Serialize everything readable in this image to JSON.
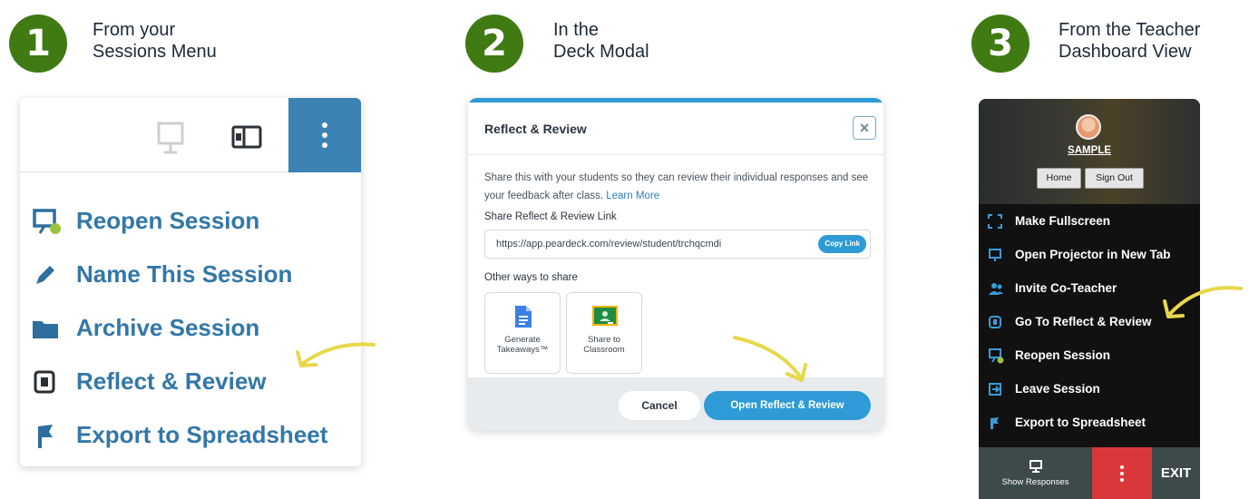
{
  "steps": [
    {
      "number": "1",
      "line1": "From your",
      "line2": "Sessions Menu"
    },
    {
      "number": "2",
      "line1": "In the",
      "line2": "Deck Modal"
    },
    {
      "number": "3",
      "line1": "From the Teacher",
      "line2": "Dashboard View"
    }
  ],
  "sessions_menu": {
    "items": [
      {
        "label": "Reopen Session",
        "icon": "projector-icon"
      },
      {
        "label": "Name This Session",
        "icon": "pencil-icon"
      },
      {
        "label": "Archive Session",
        "icon": "folder-icon"
      },
      {
        "label": "Reflect & Review",
        "icon": "reflect-icon"
      },
      {
        "label": "Export to Spreadsheet",
        "icon": "export-icon"
      }
    ]
  },
  "deck_modal": {
    "title": "Reflect & Review",
    "close": "×",
    "description": "Share this with your students so they can review their individual responses and see your feedback after class.",
    "learn_more": "Learn More",
    "link_label": "Share Reflect & Review Link",
    "link_value": "https://app.peardeck.com/review/student/trchqcmdi",
    "copy_label": "Copy Link",
    "other_label": "Other ways to share",
    "cards": [
      {
        "line1": "Generate",
        "line2": "Takeaways™",
        "icon": "google-docs-icon"
      },
      {
        "line1": "Share to",
        "line2": "Classroom",
        "icon": "google-classroom-icon"
      }
    ],
    "cancel_label": "Cancel",
    "open_label": "Open Reflect & Review"
  },
  "dashboard": {
    "username": "SAMPLE",
    "home_label": "Home",
    "signout_label": "Sign Out",
    "items": [
      {
        "label": "Make Fullscreen",
        "icon": "fullscreen-icon"
      },
      {
        "label": "Open Projector in New Tab",
        "icon": "projector-icon"
      },
      {
        "label": "Invite Co-Teacher",
        "icon": "people-icon"
      },
      {
        "label": "Go To Reflect & Review",
        "icon": "reflect-icon"
      },
      {
        "label": "Reopen Session",
        "icon": "projector-icon"
      },
      {
        "label": "Leave Session",
        "icon": "leave-icon"
      },
      {
        "label": "Export to Spreadsheet",
        "icon": "export-icon"
      }
    ],
    "show_responses": "Show Responses",
    "exit_label": "EXIT"
  },
  "colors": {
    "step_green": "#3f7a12",
    "menu_blue": "#3377a8",
    "kebab_blue": "#3b82b5",
    "modal_blue": "#2e9bd6",
    "arrow_yellow": "#e8d84a",
    "exit_red": "#d9383a"
  }
}
